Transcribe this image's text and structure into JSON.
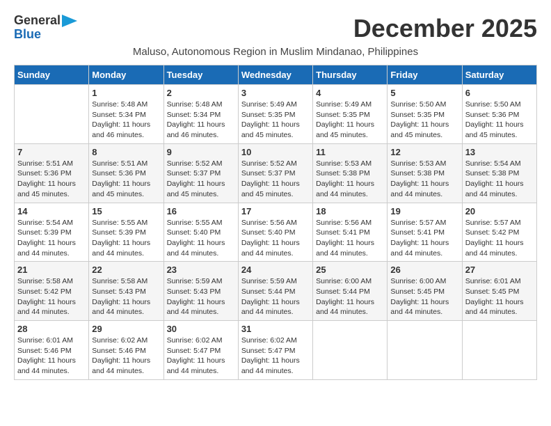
{
  "logo": {
    "line1": "General",
    "line2": "Blue"
  },
  "title": "December 2025",
  "location": "Maluso, Autonomous Region in Muslim Mindanao, Philippines",
  "weekdays": [
    "Sunday",
    "Monday",
    "Tuesday",
    "Wednesday",
    "Thursday",
    "Friday",
    "Saturday"
  ],
  "weeks": [
    [
      {
        "day": "",
        "info": ""
      },
      {
        "day": "1",
        "info": "Sunrise: 5:48 AM\nSunset: 5:34 PM\nDaylight: 11 hours\nand 46 minutes."
      },
      {
        "day": "2",
        "info": "Sunrise: 5:48 AM\nSunset: 5:34 PM\nDaylight: 11 hours\nand 46 minutes."
      },
      {
        "day": "3",
        "info": "Sunrise: 5:49 AM\nSunset: 5:35 PM\nDaylight: 11 hours\nand 45 minutes."
      },
      {
        "day": "4",
        "info": "Sunrise: 5:49 AM\nSunset: 5:35 PM\nDaylight: 11 hours\nand 45 minutes."
      },
      {
        "day": "5",
        "info": "Sunrise: 5:50 AM\nSunset: 5:35 PM\nDaylight: 11 hours\nand 45 minutes."
      },
      {
        "day": "6",
        "info": "Sunrise: 5:50 AM\nSunset: 5:36 PM\nDaylight: 11 hours\nand 45 minutes."
      }
    ],
    [
      {
        "day": "7",
        "info": "Sunrise: 5:51 AM\nSunset: 5:36 PM\nDaylight: 11 hours\nand 45 minutes."
      },
      {
        "day": "8",
        "info": "Sunrise: 5:51 AM\nSunset: 5:36 PM\nDaylight: 11 hours\nand 45 minutes."
      },
      {
        "day": "9",
        "info": "Sunrise: 5:52 AM\nSunset: 5:37 PM\nDaylight: 11 hours\nand 45 minutes."
      },
      {
        "day": "10",
        "info": "Sunrise: 5:52 AM\nSunset: 5:37 PM\nDaylight: 11 hours\nand 45 minutes."
      },
      {
        "day": "11",
        "info": "Sunrise: 5:53 AM\nSunset: 5:38 PM\nDaylight: 11 hours\nand 44 minutes."
      },
      {
        "day": "12",
        "info": "Sunrise: 5:53 AM\nSunset: 5:38 PM\nDaylight: 11 hours\nand 44 minutes."
      },
      {
        "day": "13",
        "info": "Sunrise: 5:54 AM\nSunset: 5:38 PM\nDaylight: 11 hours\nand 44 minutes."
      }
    ],
    [
      {
        "day": "14",
        "info": "Sunrise: 5:54 AM\nSunset: 5:39 PM\nDaylight: 11 hours\nand 44 minutes."
      },
      {
        "day": "15",
        "info": "Sunrise: 5:55 AM\nSunset: 5:39 PM\nDaylight: 11 hours\nand 44 minutes."
      },
      {
        "day": "16",
        "info": "Sunrise: 5:55 AM\nSunset: 5:40 PM\nDaylight: 11 hours\nand 44 minutes."
      },
      {
        "day": "17",
        "info": "Sunrise: 5:56 AM\nSunset: 5:40 PM\nDaylight: 11 hours\nand 44 minutes."
      },
      {
        "day": "18",
        "info": "Sunrise: 5:56 AM\nSunset: 5:41 PM\nDaylight: 11 hours\nand 44 minutes."
      },
      {
        "day": "19",
        "info": "Sunrise: 5:57 AM\nSunset: 5:41 PM\nDaylight: 11 hours\nand 44 minutes."
      },
      {
        "day": "20",
        "info": "Sunrise: 5:57 AM\nSunset: 5:42 PM\nDaylight: 11 hours\nand 44 minutes."
      }
    ],
    [
      {
        "day": "21",
        "info": "Sunrise: 5:58 AM\nSunset: 5:42 PM\nDaylight: 11 hours\nand 44 minutes."
      },
      {
        "day": "22",
        "info": "Sunrise: 5:58 AM\nSunset: 5:43 PM\nDaylight: 11 hours\nand 44 minutes."
      },
      {
        "day": "23",
        "info": "Sunrise: 5:59 AM\nSunset: 5:43 PM\nDaylight: 11 hours\nand 44 minutes."
      },
      {
        "day": "24",
        "info": "Sunrise: 5:59 AM\nSunset: 5:44 PM\nDaylight: 11 hours\nand 44 minutes."
      },
      {
        "day": "25",
        "info": "Sunrise: 6:00 AM\nSunset: 5:44 PM\nDaylight: 11 hours\nand 44 minutes."
      },
      {
        "day": "26",
        "info": "Sunrise: 6:00 AM\nSunset: 5:45 PM\nDaylight: 11 hours\nand 44 minutes."
      },
      {
        "day": "27",
        "info": "Sunrise: 6:01 AM\nSunset: 5:45 PM\nDaylight: 11 hours\nand 44 minutes."
      }
    ],
    [
      {
        "day": "28",
        "info": "Sunrise: 6:01 AM\nSunset: 5:46 PM\nDaylight: 11 hours\nand 44 minutes."
      },
      {
        "day": "29",
        "info": "Sunrise: 6:02 AM\nSunset: 5:46 PM\nDaylight: 11 hours\nand 44 minutes."
      },
      {
        "day": "30",
        "info": "Sunrise: 6:02 AM\nSunset: 5:47 PM\nDaylight: 11 hours\nand 44 minutes."
      },
      {
        "day": "31",
        "info": "Sunrise: 6:02 AM\nSunset: 5:47 PM\nDaylight: 11 hours\nand 44 minutes."
      },
      {
        "day": "",
        "info": ""
      },
      {
        "day": "",
        "info": ""
      },
      {
        "day": "",
        "info": ""
      }
    ]
  ]
}
